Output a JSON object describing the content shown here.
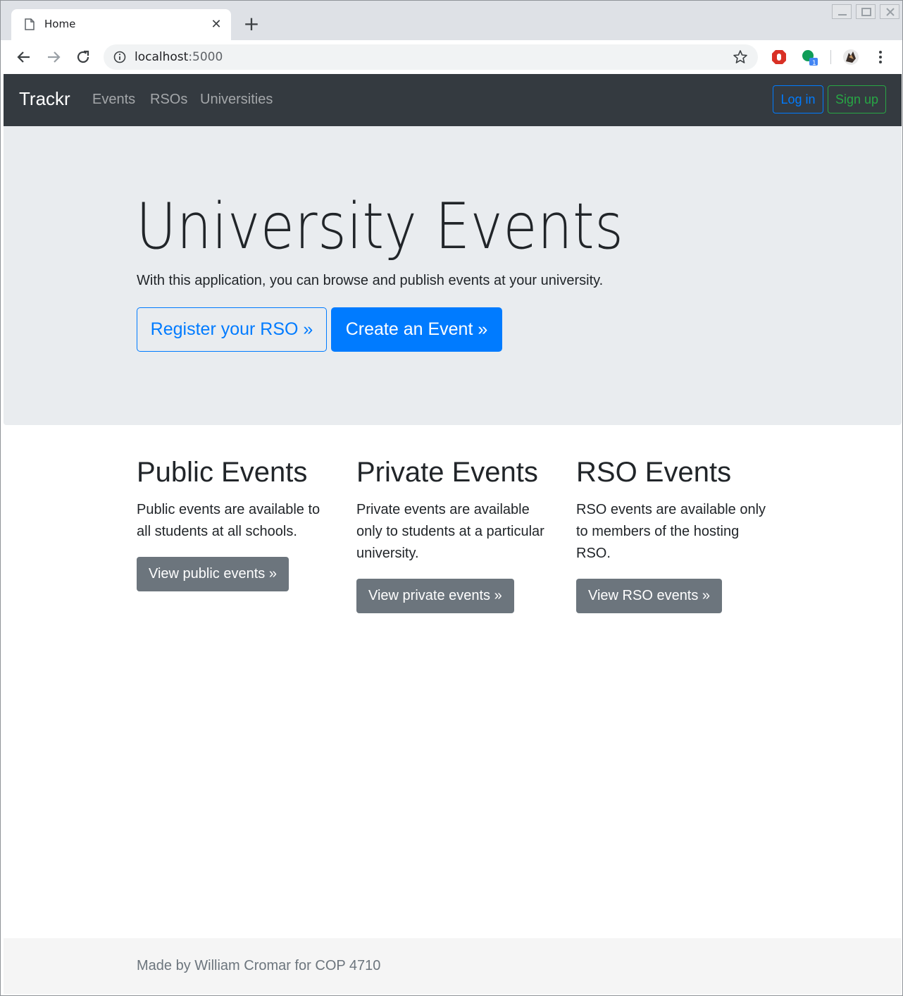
{
  "browser": {
    "tab_title": "Home",
    "url_host": "localhost",
    "url_port": ":5000",
    "extension_badge": "1"
  },
  "navbar": {
    "brand": "Trackr",
    "links": [
      "Events",
      "RSOs",
      "Universities"
    ],
    "login_label": "Log in",
    "signup_label": "Sign up"
  },
  "hero": {
    "title": "University Events",
    "lead": "With this application, you can browse and publish events at your university.",
    "register_label": "Register your RSO »",
    "create_label": "Create an Event »"
  },
  "columns": [
    {
      "heading": "Public Events",
      "text": "Public events are available to all students at all schools.",
      "button": "View public events »"
    },
    {
      "heading": "Private Events",
      "text": "Private events are available only to students at a particular university.",
      "button": "View private events »"
    },
    {
      "heading": "RSO Events",
      "text": "RSO events are available only to members of the hosting RSO.",
      "button": "View RSO events »"
    }
  ],
  "footer": {
    "text": "Made by William Cromar for COP 4710"
  },
  "colors": {
    "navbar_bg": "#343a40",
    "primary": "#007bff",
    "success": "#28a745",
    "secondary": "#6c757d",
    "jumbotron_bg": "#e9ecef"
  }
}
